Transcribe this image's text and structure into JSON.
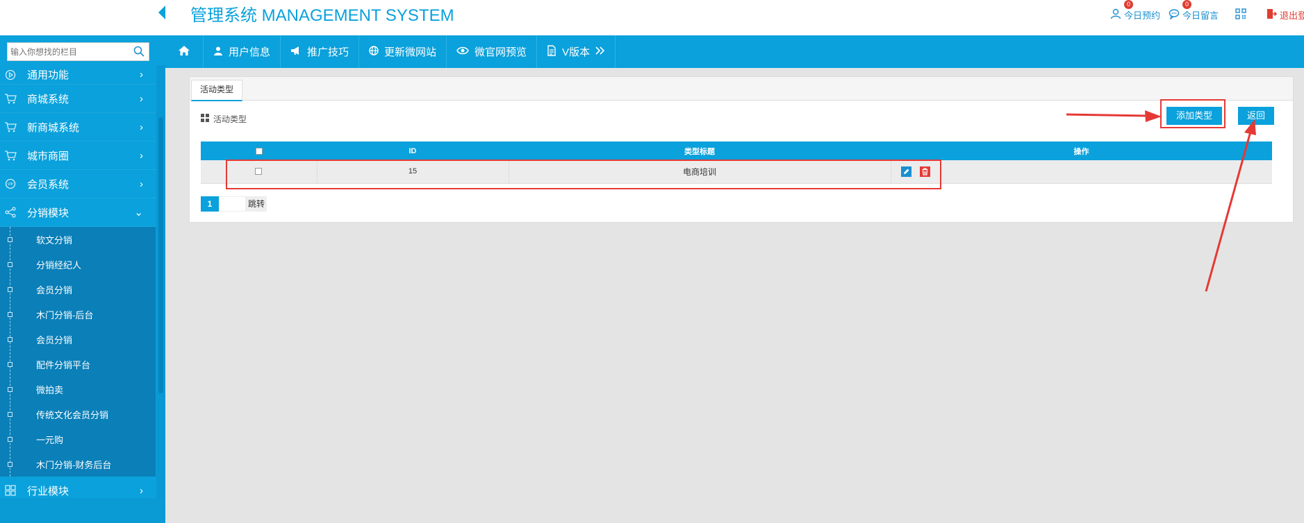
{
  "header": {
    "title": "管理系统 MANAGEMENT SYSTEM",
    "links": [
      {
        "label": "今日预约",
        "badge": "0"
      },
      {
        "label": "今日留言",
        "badge": "0"
      }
    ],
    "logout_label": "退出登"
  },
  "nav": {
    "items": [
      {
        "label": "用户信息"
      },
      {
        "label": "推广技巧"
      },
      {
        "label": "更新微网站"
      },
      {
        "label": "微官网预览"
      },
      {
        "label": "V版本"
      }
    ]
  },
  "sidebar": {
    "search_placeholder": "输入你想找的栏目",
    "menus": [
      {
        "label": "通用功能",
        "arrow": "›"
      },
      {
        "label": "商城系统",
        "arrow": "›"
      },
      {
        "label": "新商城系统",
        "arrow": "›"
      },
      {
        "label": "城市商圈",
        "arrow": "›"
      },
      {
        "label": "会员系统",
        "arrow": "›"
      },
      {
        "label": "分销模块",
        "arrow": "⌄"
      }
    ],
    "subitems": [
      "软文分销",
      "分销经纪人",
      "会员分销",
      "木门分销-后台",
      "会员分销",
      "配件分销平台",
      "微拍卖",
      "传统文化会员分销",
      "一元购",
      "木门分销-财务后台"
    ],
    "next_menu": {
      "label": "行业模块",
      "arrow": "›"
    }
  },
  "panel": {
    "tab_label": "活动类型",
    "section_title": "活动类型",
    "add_button": "添加类型",
    "back_button": "返回",
    "table": {
      "headers": [
        "ID",
        "类型标题",
        "操作"
      ],
      "rows": [
        {
          "id": "15",
          "title": "电商培训"
        }
      ]
    },
    "pager": {
      "current": "1",
      "jump_label": "跳转"
    }
  },
  "colors": {
    "primary": "#0aa1dc",
    "sidebar_sub": "#0a7fb8",
    "highlight": "#e53935"
  }
}
